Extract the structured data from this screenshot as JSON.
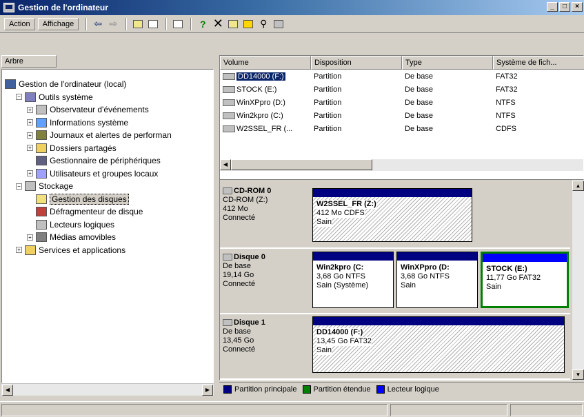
{
  "window": {
    "title": "Gestion de l'ordinateur",
    "controls": [
      "_",
      "□",
      "×"
    ]
  },
  "toolbar": {
    "action": "Action",
    "view": "Affichage"
  },
  "tree": {
    "header": "Arbre",
    "items": [
      {
        "label": "Gestion de l'ordinateur (local)",
        "level": 0,
        "expander": ""
      },
      {
        "label": "Outils système",
        "level": 1,
        "expander": "−"
      },
      {
        "label": "Observateur d'événements",
        "level": 2,
        "expander": "+"
      },
      {
        "label": "Informations système",
        "level": 2,
        "expander": "+"
      },
      {
        "label": "Journaux et alertes de performan",
        "level": 2,
        "expander": "+"
      },
      {
        "label": "Dossiers partagés",
        "level": 2,
        "expander": "+"
      },
      {
        "label": "Gestionnaire de périphériques",
        "level": 2,
        "expander": ""
      },
      {
        "label": "Utilisateurs et groupes locaux",
        "level": 2,
        "expander": "+"
      },
      {
        "label": "Stockage",
        "level": 1,
        "expander": "−"
      },
      {
        "label": "Gestion des disques",
        "level": 2,
        "expander": ""
      },
      {
        "label": "Défragmenteur de disque",
        "level": 2,
        "expander": ""
      },
      {
        "label": "Lecteurs logiques",
        "level": 2,
        "expander": ""
      },
      {
        "label": "Médias amovibles",
        "level": 2,
        "expander": "+"
      },
      {
        "label": "Services et applications",
        "level": 1,
        "expander": "+"
      }
    ]
  },
  "list": {
    "columns": [
      "Volume",
      "Disposition",
      "Type",
      "Système de fich..."
    ],
    "rows": [
      [
        "DD14000 (F:)",
        "Partition",
        "De base",
        "FAT32"
      ],
      [
        "STOCK (E:)",
        "Partition",
        "De base",
        "FAT32"
      ],
      [
        "WinXPpro (D:)",
        "Partition",
        "De base",
        "NTFS"
      ],
      [
        "Win2kpro (C:)",
        "Partition",
        "De base",
        "NTFS"
      ],
      [
        "W2SSEL_FR (...",
        "Partition",
        "De base",
        "CDFS"
      ]
    ]
  },
  "disks": [
    {
      "name": "CD-ROM 0",
      "type": "CD-ROM (Z:)",
      "size": "412 Mo",
      "status": "Connecté",
      "partitions": [
        {
          "name": "W2SSEL_FR  (Z:)",
          "detail": "412 Mo CDFS",
          "health": "Sain"
        }
      ]
    },
    {
      "name": "Disque 0",
      "type": "De base",
      "size": "19,14 Go",
      "status": "Connecté",
      "partitions": [
        {
          "name": "Win2kpro  (C:",
          "detail": "3,68 Go NTFS",
          "health": "Sain (Système)"
        },
        {
          "name": "WinXPpro  (D:",
          "detail": "3,68 Go NTFS",
          "health": "Sain"
        },
        {
          "name": "STOCK  (E:)",
          "detail": "11,77 Go FAT32",
          "health": "Sain"
        }
      ]
    },
    {
      "name": "Disque 1",
      "type": "De base",
      "size": "13,45 Go",
      "status": "Connecté",
      "partitions": [
        {
          "name": "DD14000  (F:)",
          "detail": "13,45 Go FAT32",
          "health": "Sain"
        }
      ]
    }
  ],
  "legend": [
    "Partition principale",
    "Partition étendue",
    "Lecteur logique"
  ],
  "colors": {
    "primary": "#000080",
    "extended": "#008000",
    "logical": "#0000ff"
  }
}
